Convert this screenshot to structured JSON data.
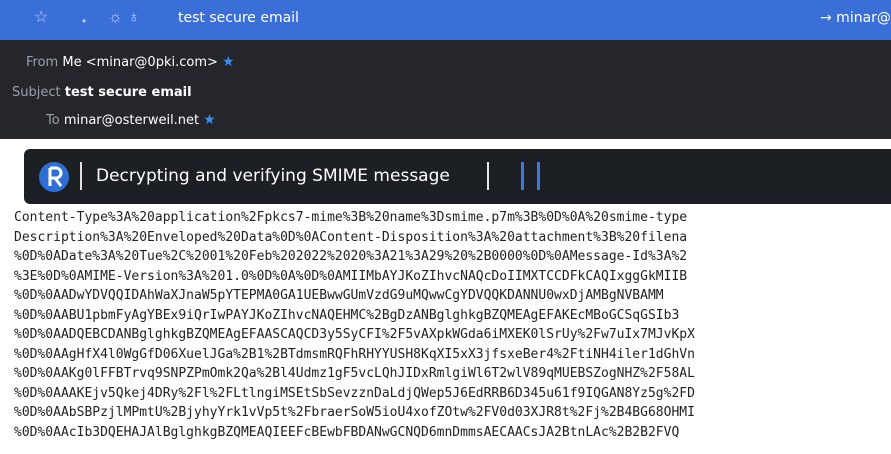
{
  "toolbar": {
    "title": "test secure email",
    "right_text": "→ minar@",
    "icons": [
      "star-icon",
      "dot-icon",
      "flame-icon"
    ]
  },
  "header": {
    "from_label": "From",
    "from_value": "Me <minar@0pki.com>",
    "subject_label": "Subject",
    "subject_value": "test secure email",
    "to_label": "To",
    "to_value": "minar@osterweil.net"
  },
  "banner": {
    "message": "Decrypting and verifying SMIME message"
  },
  "raw_lines": [
    "Content-Type%3A%20application%2Fpkcs7-mime%3B%20name%3Dsmime.p7m%3B%0D%0A%20smime-type",
    "Description%3A%20Enveloped%20Data%0D%0AContent-Disposition%3A%20attachment%3B%20filena",
    "%0D%0ADate%3A%20Tue%2C%2001%20Feb%202022%2020%3A21%3A29%20%2B0000%0D%0AMessage-Id%3A%2",
    "%3E%0D%0AMIME-Version%3A%201.0%0D%0A%0D%0AMIIMbAYJKoZIhvcNAQcDoIIMXTCCDFkCAQIxggGkMIIB",
    "%0D%0AADwYDVQQIDAhWaXJnaW5pYTEPMA0GA1UEBwwGUmVzdG9uMQwwCgYDVQQKDANNU0wxDjAMBgNVBAMM",
    "%0D%0AABU1pbmFyAgYBEx9iQrIwPAYJKoZIhvcNAQEHMC%2BgDzANBglghkgBZQMEAgEFAKEcMBoGCSqGSIb3",
    "%0D%0AADQEBCDANBglghkgBZQMEAgEFAASCAQCD3y5SyCFI%2F5vAXpkWGda6iMXEK0lSrUy%2Fw7uIx7MJvKpX",
    "%0D%0AAgHfX4l0WgGfD06XuelJGa%2B1%2BTdmsmRQFhRHYYUSH8KqXI5xX3jfsxeBer4%2FtiNH4iler1dGhVn",
    "%0D%0AAKg0lFFBTrvq9SNPZPmOmk2Qa%2Bl4Udmz1gF5vcLQhJIDxRmlgiWl6T2wlV89qMUEBSZogNHZ%2F58AL",
    "%0D%0AAAKEjv5Qkej4DRy%2Fl%2FLtlngiMSEtSbSevzznDaLdjQWep5J6EdRRB6D345u61f9IQGAN8Yz5g%2FD",
    "%0D%0AAbSBPzjlMPmtU%2BjyhyYrk1vVp5t%2FbraerSoW5ioU4xofZOtw%2FV0d03XJR8t%2Fj%2B4BG68OHMI",
    "%0D%0AAcIb3DQEHAJAlBglghkgBZQMEAQIEEFcBEwbFBDANwGCNQD6mnDmmsAECAACsJA2BtnLAc%2B2B2FVQ"
  ]
}
